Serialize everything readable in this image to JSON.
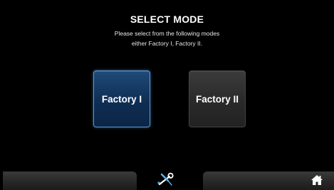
{
  "header": {
    "title": "SELECT MODE",
    "subtitle_line1": "Please select from the following modes",
    "subtitle_line2": "either Factory I, Factory II."
  },
  "modes": [
    {
      "label": "Factory I",
      "selected": true
    },
    {
      "label": "Factory II",
      "selected": false
    }
  ],
  "footer": {
    "center_icon": "tools-icon",
    "right_icon": "home-icon"
  },
  "colors": {
    "background": "#000000",
    "selected_border": "#5a9ad8",
    "selected_fill": "#0f2e54",
    "unselected_fill": "#2a2a2a",
    "icon_accent": "#5ab4e6"
  }
}
